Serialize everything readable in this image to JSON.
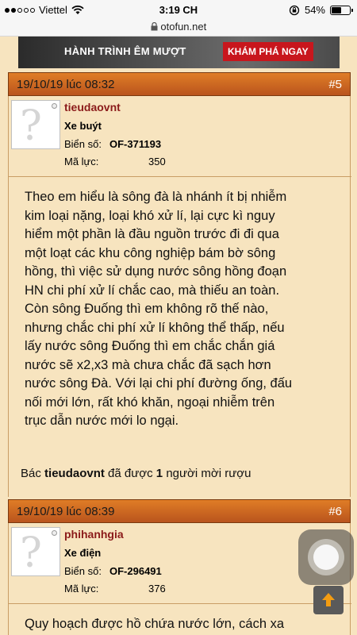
{
  "status_bar": {
    "carrier": "Viettel",
    "time": "3:19 CH",
    "battery": "54%",
    "battery_level": 0.54
  },
  "browser": {
    "url": "otofun.net"
  },
  "banner": {
    "text": "HÀNH TRÌNH ÊM MƯỢT",
    "cta": "KHÁM PHÁ NGAY"
  },
  "posts": [
    {
      "date": "19/10/19 lúc 08:32",
      "number": "#5",
      "username": "tieudaovnt",
      "user_title": "Xe buýt",
      "plate_label": "Biển số:",
      "plate": "OF-371193",
      "power_label": "Mã lực:",
      "power": "350",
      "message": [
        "Theo em hiểu là sông đà là nhánh ít bị nhiễm",
        "kim loại nặng, loại khó xử lí, lại cực kì nguy",
        "hiểm một phần là đầu nguồn trước đi đi qua",
        "một loạt các khu công nghiệp bám bờ sông",
        "hồng, thì việc sử dụng nước sông hồng đoạn",
        "HN chi phí xử lí chắc cao, mà thiếu an toàn.",
        "Còn sông Đuống thì em không rõ thế nào,",
        "nhưng chắc chi phí xử lí không thể thấp, nếu",
        "lấy nước sông Đuống thì em chắc chắn giá",
        "nước sẽ x2,x3 mà chưa chắc đã sạch hơn",
        "nước sông Đà. Với lại chi phí đường ống, đấu",
        "nối mới lớn, rất khó khăn, ngoại nhiễm trên",
        "trục dẫn nước mới lo ngại."
      ],
      "likes_prefix": "Bác",
      "likes_user": "tieudaovnt",
      "likes_mid": "đã được",
      "likes_count": "1",
      "likes_suffix": "người mời rượu"
    },
    {
      "date": "19/10/19 lúc 08:39",
      "number": "#6",
      "username": "phihanhgia",
      "user_title": "Xe điện",
      "plate_label": "Biển số:",
      "plate": "OF-296491",
      "power_label": "Mã lực:",
      "power": "376",
      "message_first_line": "Quy hoạch được hồ chứa nước lớn, cách xa"
    }
  ]
}
